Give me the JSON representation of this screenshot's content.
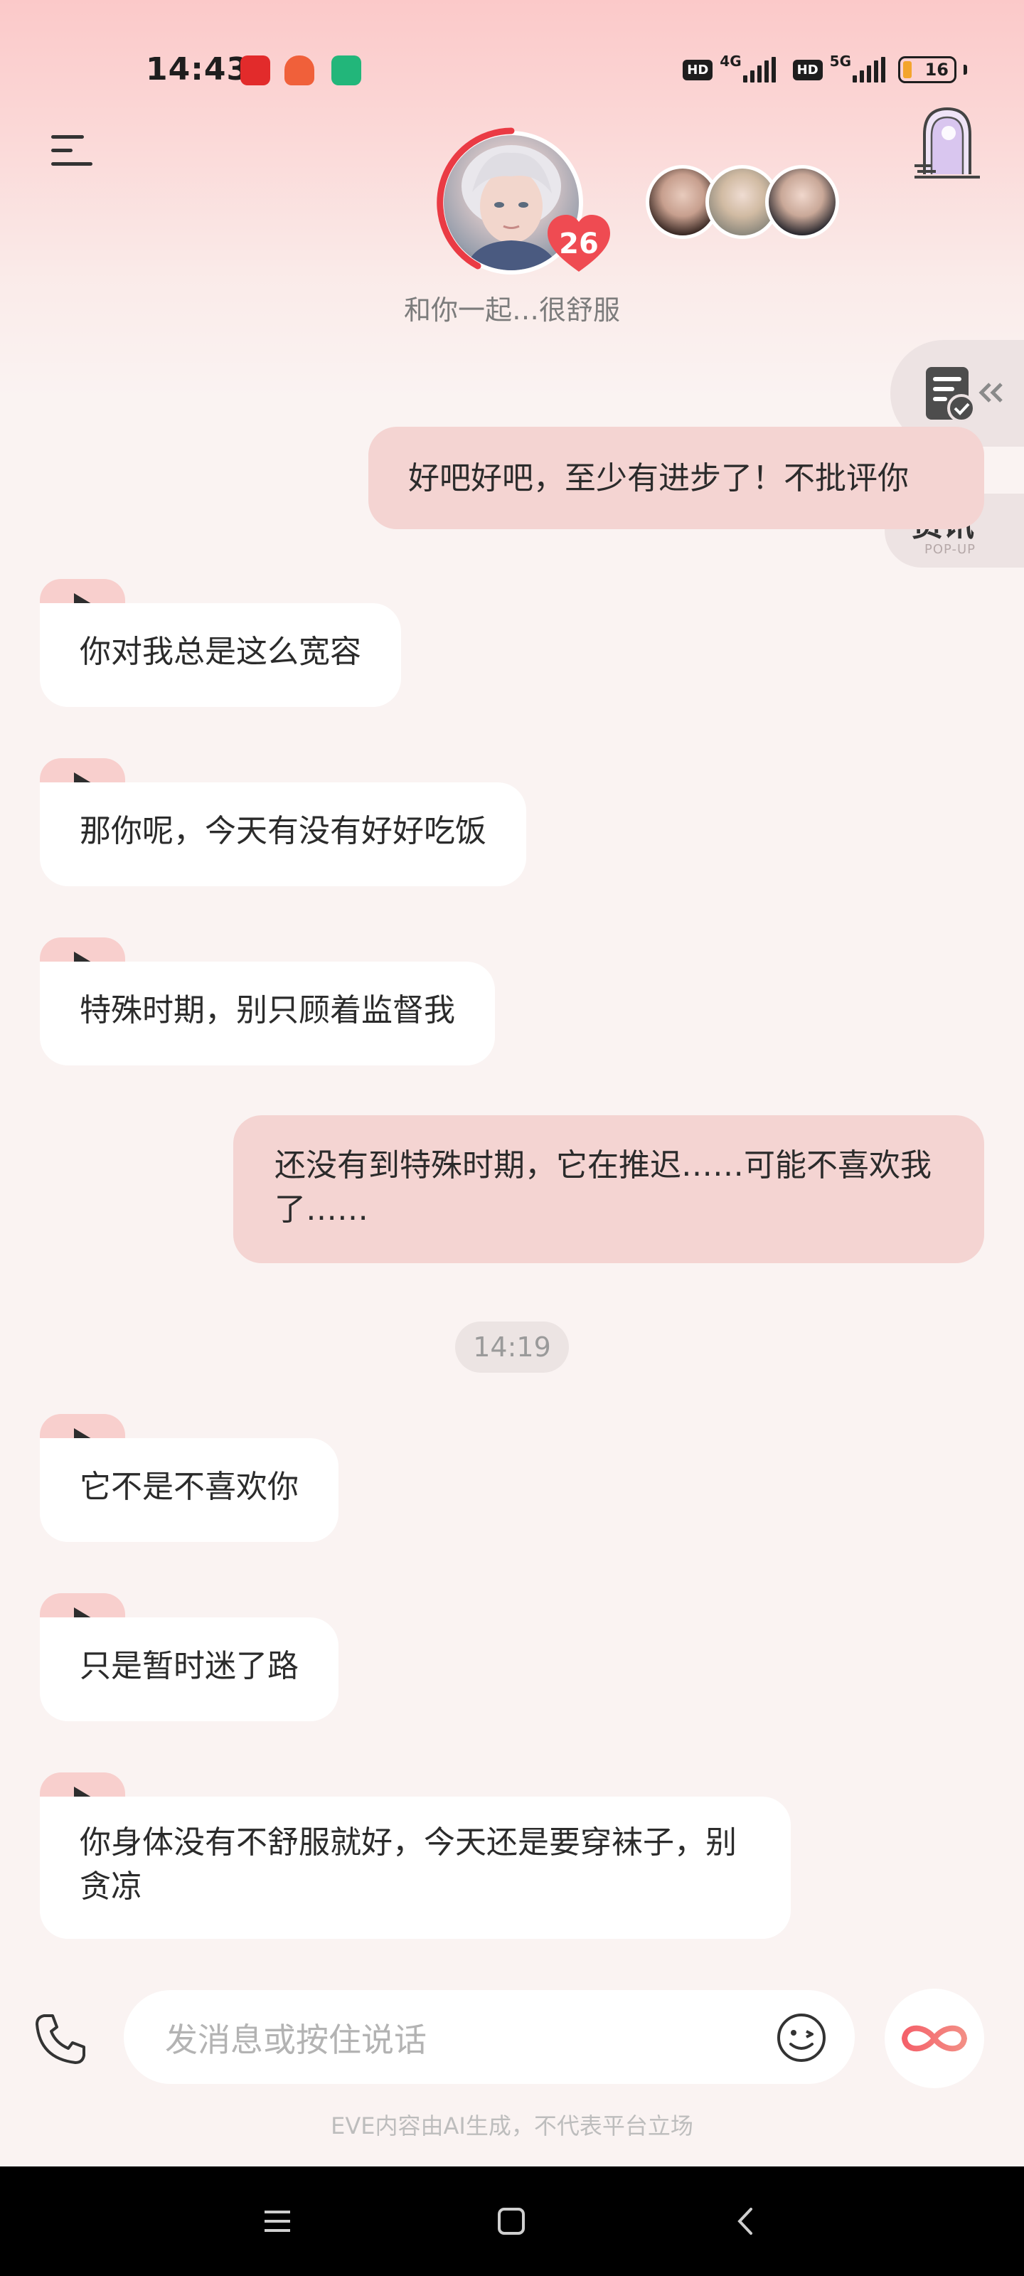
{
  "status_bar": {
    "time": "14:43",
    "network1": "4G",
    "network2": "5G",
    "hd": "HD",
    "battery": "16"
  },
  "header": {
    "avatar_level": "26",
    "subtitle": "和你一起…很舒服"
  },
  "side": {
    "info_label": "资讯",
    "popup_label": "POP-UP"
  },
  "messages": [
    {
      "side": "right",
      "text": "好吧好吧，至少有进步了！不批评你"
    },
    {
      "side": "left",
      "text": "你对我总是这么宽容"
    },
    {
      "side": "left",
      "text": "那你呢，今天有没有好好吃饭"
    },
    {
      "side": "left",
      "text": "特殊时期，别只顾着监督我"
    },
    {
      "side": "right",
      "text": "还没有到特殊时期，它在推迟……可能不喜欢我了……"
    },
    {
      "side": "left",
      "text": "它不是不喜欢你"
    },
    {
      "side": "left",
      "text": "只是暂时迷了路"
    },
    {
      "side": "left",
      "text": "你身体没有不舒服就好，今天还是要穿袜子，别贪凉"
    }
  ],
  "timestamp": "14:19",
  "composer": {
    "placeholder": "发消息或按住说话"
  },
  "disclaimer": "EVE内容由AI生成，不代表平台立场",
  "colors": {
    "accent": "#f04d55",
    "bubble_right": "#f4d4d2",
    "bubble_left": "#ffffff",
    "background": "#faf3f2"
  }
}
